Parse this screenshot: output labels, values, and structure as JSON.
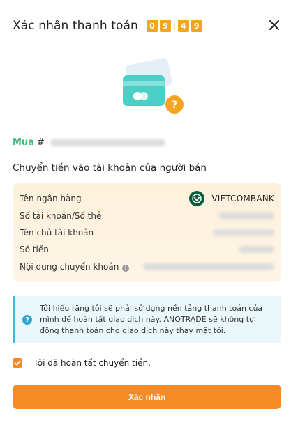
{
  "header": {
    "title": "Xác nhận thanh toán",
    "timer": [
      "0",
      "9",
      "4",
      "9"
    ],
    "timer_separator": ":",
    "close_icon": "close-icon"
  },
  "purchase": {
    "label": "Mua",
    "hash": "#"
  },
  "transfer_title": "Chuyển tiền vào tài khoản của người bán",
  "bank_details": {
    "bank_name_label": "Tên ngân hàng",
    "bank_name_value": "VIETCOMBANK",
    "account_number_label": "Số tài khoản/Số thẻ",
    "account_holder_label": "Tên chủ tài khoản",
    "amount_label": "Số tiền",
    "transfer_note_label": "Nội dung chuyển khoản",
    "info_icon": "info-icon"
  },
  "notice": {
    "icon": "question-icon",
    "text": "Tôi hiểu rằng tôi sẽ phải sử dụng nền tảng thanh toán của mình để hoàn tất giao dịch này. ANOTRADE sẽ không tự động thanh toán cho giao dịch này thay mặt tôi."
  },
  "confirmation_checkbox": {
    "checked": true,
    "label": "Tôi đã hoàn tất chuyển tiền."
  },
  "confirm_button": {
    "label": "Xác nhận"
  },
  "colors": {
    "accent": "#f68b26",
    "timer": "#f5a524",
    "buy_label": "#3cba7a",
    "notice_border": "#3db8dc",
    "bank_box": "#fdf1db"
  }
}
